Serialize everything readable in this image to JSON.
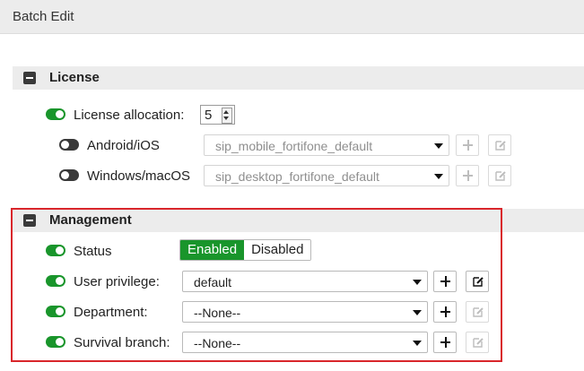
{
  "window": {
    "title": "Batch Edit"
  },
  "license": {
    "section_title": "License",
    "allocation": {
      "label": "License allocation:",
      "value": "5"
    },
    "android": {
      "label": "Android/iOS",
      "value": "sip_mobile_fortifone_default"
    },
    "windows": {
      "label": "Windows/macOS",
      "value": "sip_desktop_fortifone_default"
    }
  },
  "management": {
    "section_title": "Management",
    "status": {
      "label": "Status",
      "enabled_label": "Enabled",
      "disabled_label": "Disabled",
      "selected": "Enabled"
    },
    "user_privilege": {
      "label": "User privilege:",
      "value": "default"
    },
    "department": {
      "label": "Department:",
      "value": "--None--"
    },
    "survival_branch": {
      "label": "Survival branch:",
      "value": "--None--"
    }
  },
  "colors": {
    "accent": "#19952b",
    "highlight": "#d9262b",
    "header_bg": "#ececec"
  },
  "icons": [
    "collapse-icon",
    "toggle-icon",
    "chevron-down-icon",
    "plus-icon",
    "edit-icon"
  ]
}
